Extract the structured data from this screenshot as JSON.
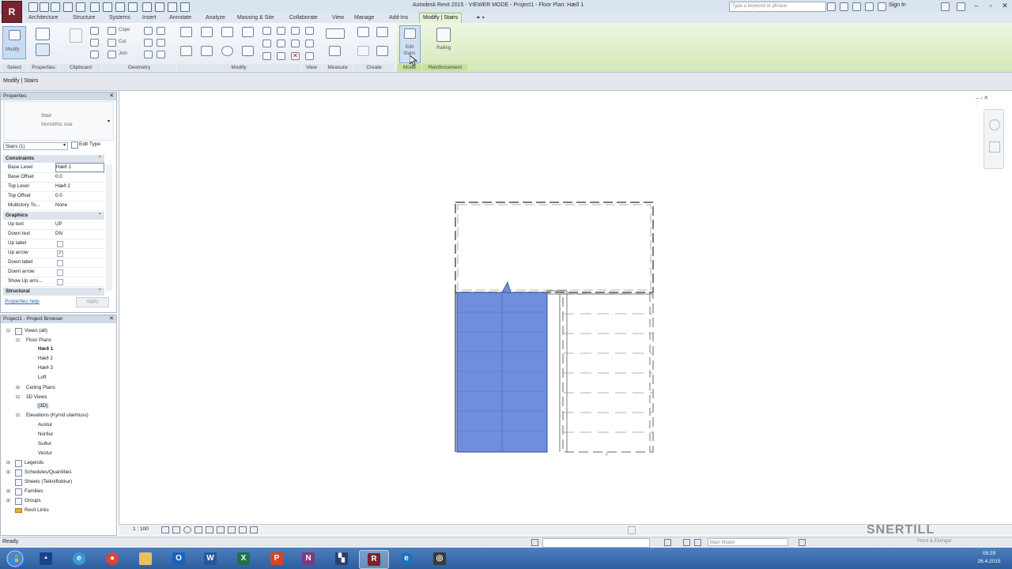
{
  "window": {
    "title": "Autodesk Revit 2015 - VIEWER MODE -   Project1 - Floor Plan: Hæð 1",
    "search_placeholder": "Type a keyword or phrase",
    "sign_in": "Sign In",
    "app_button": "R"
  },
  "ribbon_tabs": [
    {
      "label": "Architecture"
    },
    {
      "label": "Structure"
    },
    {
      "label": "Systems"
    },
    {
      "label": "Insert"
    },
    {
      "label": "Annotate"
    },
    {
      "label": "Analyze"
    },
    {
      "label": "Massing & Site"
    },
    {
      "label": "Collaborate"
    },
    {
      "label": "View"
    },
    {
      "label": "Manage"
    },
    {
      "label": "Add-Ins"
    },
    {
      "label": "Modify | Stairs"
    }
  ],
  "ribbon": {
    "modify": "Modify",
    "cope": "Cope",
    "cut": "Cut",
    "join": "Join",
    "edit_sketch_l1": "Edit",
    "edit_sketch_l2": "Stairs",
    "railing": "Railing",
    "panels": {
      "select": "Select",
      "properties": "Properties",
      "clipboard": "Clipboard",
      "geometry": "Geometry",
      "modify": "Modify",
      "view": "View",
      "measure": "Measure",
      "create": "Create",
      "mode": "Mode",
      "reinforcement": "Reinforcement"
    }
  },
  "options_bar": {
    "context": "Modify | Stairs"
  },
  "properties": {
    "title": "Properties",
    "type_name": "Stair",
    "type_sub": "Monolithic stair",
    "instance_filter": "Stairs (1)",
    "edit_type": "Edit Type",
    "groups": {
      "constraints": "Constraints",
      "graphics": "Graphics",
      "structural": "Structural"
    },
    "rows": [
      {
        "name": "Base Level",
        "value": "Hæð 1"
      },
      {
        "name": "Base Offset",
        "value": "0.0"
      },
      {
        "name": "Top Level",
        "value": "Hæð 2"
      },
      {
        "name": "Top Offset",
        "value": "0.0"
      },
      {
        "name": "Multistory To...",
        "value": "None"
      },
      {
        "name": "Up text",
        "value": "UP"
      },
      {
        "name": "Down text",
        "value": "DN"
      },
      {
        "name": "Up label",
        "value": ""
      },
      {
        "name": "Up arrow",
        "value": "✓"
      },
      {
        "name": "Down label",
        "value": ""
      },
      {
        "name": "Down arrow",
        "value": ""
      },
      {
        "name": "Show Up arro...",
        "value": ""
      }
    ],
    "help_link": "Properties help",
    "apply": "Apply"
  },
  "browser": {
    "title": "Project1 - Project Browser",
    "items": [
      {
        "label": "Views (all)"
      },
      {
        "label": "Floor Plans"
      },
      {
        "label": "Hæð 1"
      },
      {
        "label": "Hæð 2"
      },
      {
        "label": "Hæð 3"
      },
      {
        "label": "Loft"
      },
      {
        "label": "Ceiling Plans"
      },
      {
        "label": "3D Views"
      },
      {
        "label": "{3D}"
      },
      {
        "label": "Elevations (Kyrnd utanhuss)"
      },
      {
        "label": "Austur"
      },
      {
        "label": "Norður"
      },
      {
        "label": "Suður"
      },
      {
        "label": "Vestur"
      },
      {
        "label": "Legends"
      },
      {
        "label": "Schedules/Quantities"
      },
      {
        "label": "Sheets (Teikniflokkur)"
      },
      {
        "label": "Families"
      },
      {
        "label": "Groups"
      },
      {
        "label": "Revit Links"
      }
    ]
  },
  "view_bar": {
    "scale": "1 : 100"
  },
  "status_bar": {
    "text": "Ready",
    "filter": "Main Model"
  },
  "watermark": {
    "brand": "SNERTILL",
    "tagline": "Prent & Einingar"
  },
  "taskbar": {
    "clock_time": "09:29",
    "clock_date": "26.4.2015"
  },
  "colors": {
    "stair_fill": "#6f8fdc",
    "context_tab": "#e8f4d6",
    "taskbar": "#3a6cb0",
    "app_button": "#7a2230"
  }
}
